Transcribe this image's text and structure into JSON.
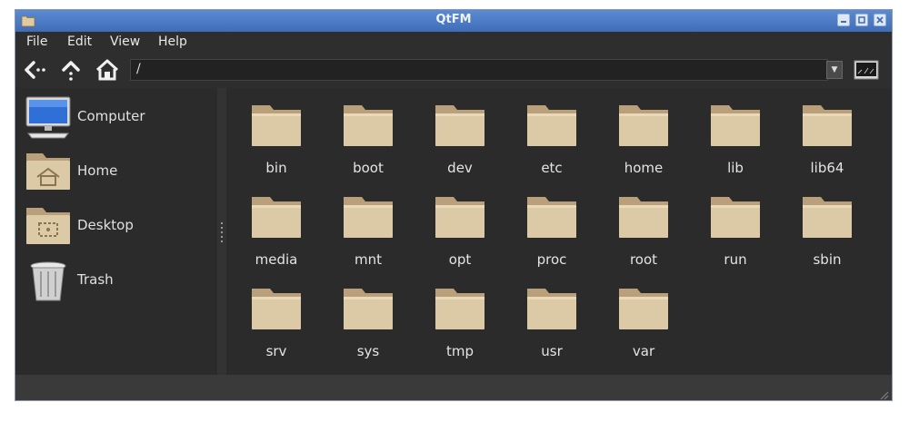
{
  "window": {
    "title": "QtFM"
  },
  "menu": [
    "File",
    "Edit",
    "View",
    "Help"
  ],
  "toolbar": {
    "path": "/"
  },
  "sidebar": [
    {
      "label": "Computer",
      "icon": "computer-icon"
    },
    {
      "label": "Home",
      "icon": "home-folder-icon"
    },
    {
      "label": "Desktop",
      "icon": "desktop-folder-icon"
    },
    {
      "label": "Trash",
      "icon": "trash-icon"
    }
  ],
  "folders": [
    "bin",
    "boot",
    "dev",
    "etc",
    "home",
    "lib",
    "lib64",
    "media",
    "mnt",
    "opt",
    "proc",
    "root",
    "run",
    "sbin",
    "srv",
    "sys",
    "tmp",
    "usr",
    "var"
  ],
  "colors": {
    "titlebar": "#4a79c4",
    "folder": "#dcc9a5",
    "folder_dark": "#b9a07a",
    "background": "#2b2b2b"
  }
}
